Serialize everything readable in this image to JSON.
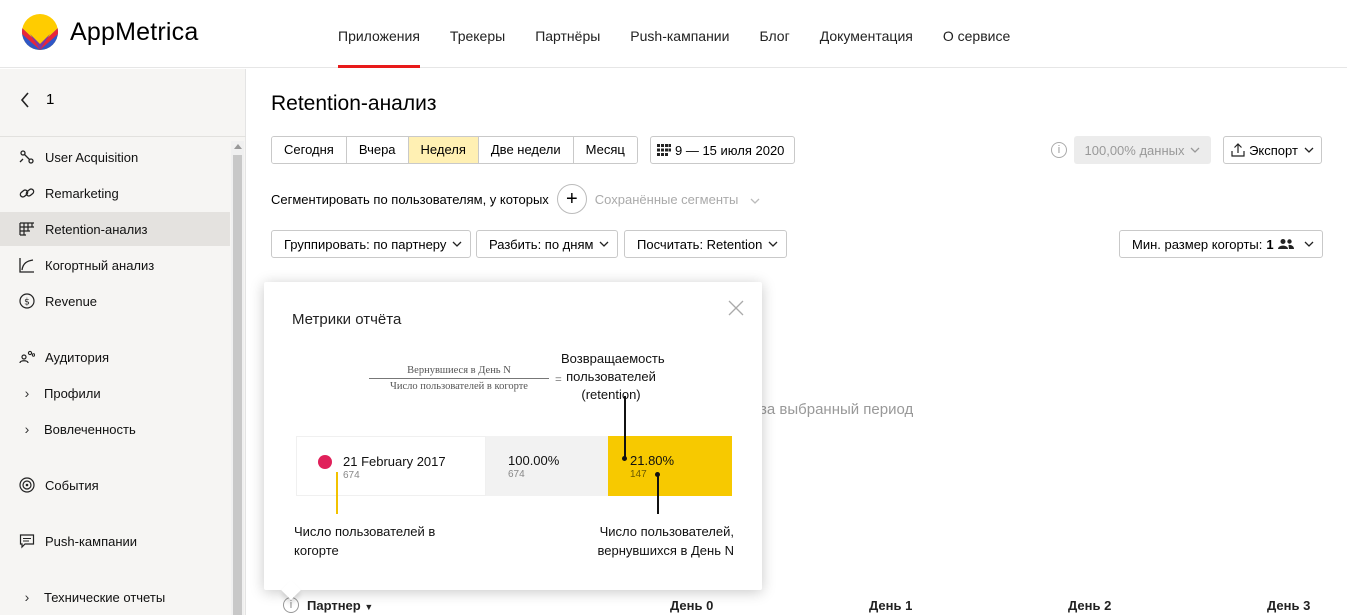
{
  "brand": {
    "name": "AppMetrica"
  },
  "nav": [
    "Приложения",
    "Трекеры",
    "Партнёры",
    "Push-кампании",
    "Блог",
    "Документация",
    "О сервисе"
  ],
  "sidebar": {
    "back_label": "1",
    "items": [
      {
        "label": "User Acquisition",
        "icon": "routes-icon"
      },
      {
        "label": "Remarketing",
        "icon": "link-icon"
      },
      {
        "label": "Retention-анализ",
        "icon": "retention-grid-icon",
        "active": true
      },
      {
        "label": "Когортный анализ",
        "icon": "cohort-chart-icon"
      },
      {
        "label": "Revenue",
        "icon": "dollar-icon"
      },
      {
        "label": "Аудитория",
        "icon": "audience-icon"
      },
      {
        "label": "Профили",
        "icon": "chevron-right-icon"
      },
      {
        "label": "Вовлеченность",
        "icon": "chevron-right-icon"
      },
      {
        "label": "События",
        "icon": "target-icon"
      },
      {
        "label": "Push-кампании",
        "icon": "message-icon"
      },
      {
        "label": "Технические отчеты",
        "icon": "chevron-right-icon"
      }
    ]
  },
  "main": {
    "title": "Retention-анализ",
    "periods": [
      "Сегодня",
      "Вчера",
      "Неделя",
      "Две недели",
      "Месяц"
    ],
    "active_period": "Неделя",
    "date_range": "9 — 15 июля 2020",
    "info_glyph": "i",
    "data_sample": "100,00% данных",
    "export_label": "Экспорт",
    "segment_text": "Сегментировать по пользователям, у которых",
    "plus_glyph": "+",
    "saved_segments": "Сохранённые сегменты",
    "group_by": "Группировать: по партнеру",
    "split_by": "Разбить: по дням",
    "calculate": "Посчитать: Retention",
    "min_cohort_label": "Мин. размер когорты:",
    "min_cohort_value": "1",
    "empty_message": "за выбранный период",
    "table_columns": {
      "partner": "Партнер",
      "day0": "День 0",
      "day1": "День 1",
      "day2": "День 2",
      "day3": "День 3"
    }
  },
  "popup": {
    "title": "Метрики отчёта",
    "formula_numerator": "Вернувшиеся в День N",
    "formula_denominator": "Число пользователей в когорте",
    "formula_eq": "=",
    "retention_label": "Возвращаемость пользователей (retention)",
    "example": {
      "date": "21 February 2017",
      "cohort_size": "674",
      "day0_pct": "100.00%",
      "day0_count": "674",
      "dayn_pct": "21.80%",
      "dayn_count": "147"
    },
    "caption_left": "Число пользователей в когорте",
    "caption_right": "Число пользователей, вернувшихся в День N"
  },
  "colors": {
    "accent_red": "#e81a1a",
    "highlight_yellow": "#f7c900",
    "active_period_bg": "#fff0b3",
    "cohort_dot": "#e0205a"
  }
}
